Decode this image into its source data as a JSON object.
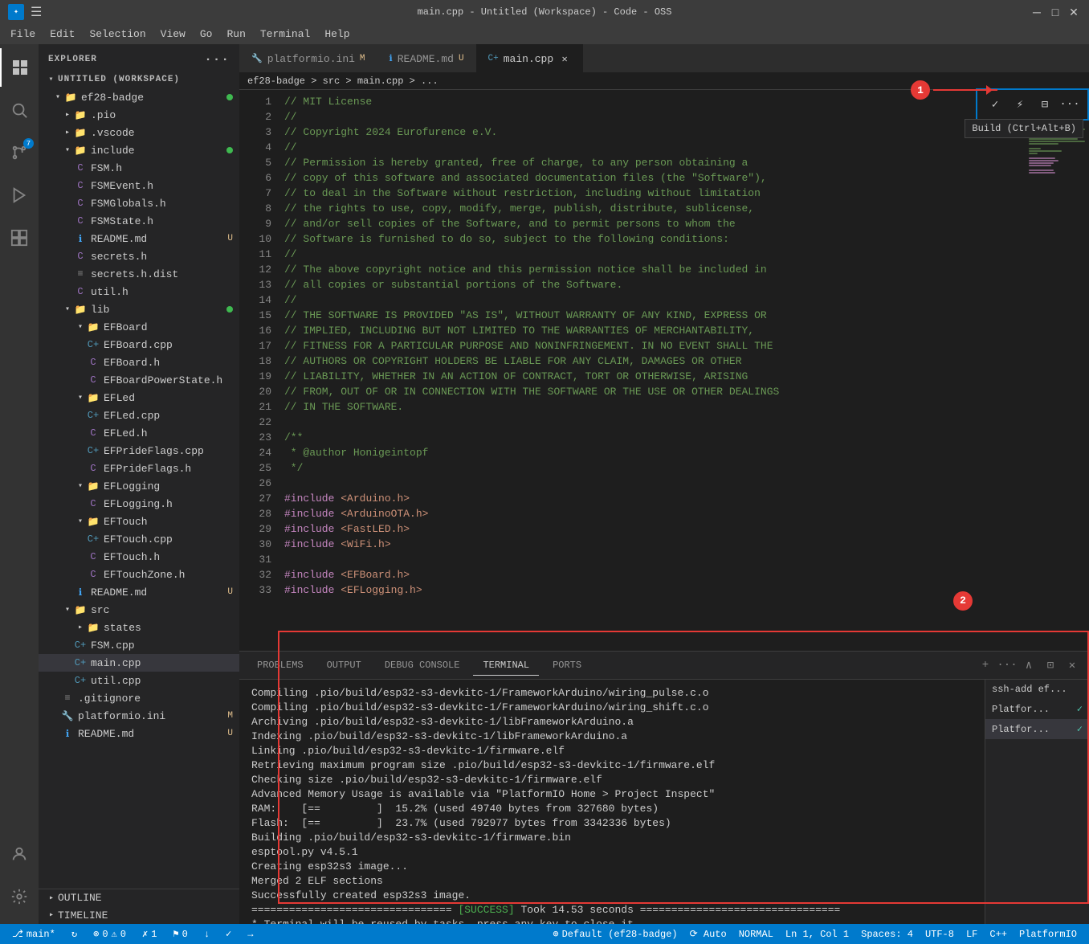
{
  "titleBar": {
    "title": "main.cpp - Untitled (Workspace) - Code - OSS",
    "winMin": "─",
    "winMax": "□",
    "winClose": "✕"
  },
  "menuBar": {
    "items": [
      "File",
      "Edit",
      "Selection",
      "View",
      "Go",
      "Run",
      "Terminal",
      "Help"
    ]
  },
  "activityBar": {
    "icons": [
      {
        "name": "explorer-icon",
        "symbol": "⬜",
        "active": true
      },
      {
        "name": "search-icon",
        "symbol": "🔍",
        "active": false
      },
      {
        "name": "source-control-icon",
        "symbol": "⎇",
        "active": false,
        "badge": "7"
      },
      {
        "name": "run-debug-icon",
        "symbol": "▷",
        "active": false
      },
      {
        "name": "extensions-icon",
        "symbol": "⊞",
        "active": false
      },
      {
        "name": "remote-explorer-icon",
        "symbol": "⊙",
        "active": false
      }
    ],
    "bottomIcons": [
      {
        "name": "account-icon",
        "symbol": "👤"
      },
      {
        "name": "settings-icon",
        "symbol": "⚙"
      }
    ]
  },
  "sidebar": {
    "header": "Explorer",
    "tree": {
      "workspace": "UNTITLED (WORKSPACE)",
      "items": [
        {
          "label": "ef28-badge",
          "type": "folder",
          "expanded": true,
          "indent": 0,
          "hasDot": true
        },
        {
          "label": ".pio",
          "type": "folder",
          "expanded": false,
          "indent": 1
        },
        {
          "label": ".vscode",
          "type": "folder",
          "expanded": false,
          "indent": 1
        },
        {
          "label": "include",
          "type": "folder",
          "expanded": true,
          "indent": 1,
          "hasDot": true
        },
        {
          "label": "FSM.h",
          "type": "c-header",
          "indent": 2
        },
        {
          "label": "FSMEvent.h",
          "type": "c-header",
          "indent": 2
        },
        {
          "label": "FSMGlobals.h",
          "type": "c-header",
          "indent": 2
        },
        {
          "label": "FSMState.h",
          "type": "c-header",
          "indent": 2
        },
        {
          "label": "README.md",
          "type": "info",
          "indent": 2,
          "modified": "U"
        },
        {
          "label": "secrets.h",
          "type": "c-header",
          "indent": 2
        },
        {
          "label": "secrets.h.dist",
          "type": "file",
          "indent": 2
        },
        {
          "label": "util.h",
          "type": "c-header",
          "indent": 2
        },
        {
          "label": "lib",
          "type": "folder",
          "expanded": true,
          "indent": 1,
          "hasDot": true
        },
        {
          "label": "EFBoard",
          "type": "folder",
          "expanded": true,
          "indent": 2
        },
        {
          "label": "EFBoard.cpp",
          "type": "c-plus",
          "indent": 3
        },
        {
          "label": "EFBoard.h",
          "type": "c-header",
          "indent": 3
        },
        {
          "label": "EFBoardPowerState.h",
          "type": "c-header",
          "indent": 3
        },
        {
          "label": "EFLed",
          "type": "folder",
          "expanded": true,
          "indent": 2
        },
        {
          "label": "EFLed.cpp",
          "type": "c-plus",
          "indent": 3
        },
        {
          "label": "EFLed.h",
          "type": "c-header",
          "indent": 3
        },
        {
          "label": "EFPrideFlags.cpp",
          "type": "c-plus",
          "indent": 3
        },
        {
          "label": "EFPrideFlags.h",
          "type": "c-header",
          "indent": 3
        },
        {
          "label": "EFLogging",
          "type": "folder",
          "expanded": true,
          "indent": 2
        },
        {
          "label": "EFLogging.h",
          "type": "c-header",
          "indent": 3
        },
        {
          "label": "EFTouch",
          "type": "folder",
          "expanded": true,
          "indent": 2
        },
        {
          "label": "EFTouch.cpp",
          "type": "c-plus",
          "indent": 3
        },
        {
          "label": "EFTouch.h",
          "type": "c-header",
          "indent": 3
        },
        {
          "label": "EFTouchZone.h",
          "type": "c-header",
          "indent": 3
        },
        {
          "label": "README.md",
          "type": "info",
          "indent": 2,
          "modified": "U"
        },
        {
          "label": "src",
          "type": "folder",
          "expanded": true,
          "indent": 1
        },
        {
          "label": "states",
          "type": "folder",
          "expanded": false,
          "indent": 2
        },
        {
          "label": "FSM.cpp",
          "type": "c-plus",
          "indent": 2
        },
        {
          "label": "main.cpp",
          "type": "c-plus",
          "indent": 2,
          "active": true
        },
        {
          "label": "util.cpp",
          "type": "c-plus",
          "indent": 2
        },
        {
          "label": ".gitignore",
          "type": "file",
          "indent": 1
        },
        {
          "label": "platformio.ini",
          "type": "platformio",
          "indent": 1,
          "modified": "M"
        },
        {
          "label": "README.md",
          "type": "info",
          "indent": 1,
          "modified": "U"
        }
      ]
    },
    "outline": "OUTLINE",
    "timeline": "TIMELINE"
  },
  "tabs": [
    {
      "label": "platformio.ini",
      "modified": "M",
      "active": false,
      "type": "platformio"
    },
    {
      "label": "README.md",
      "modified": "U",
      "active": false,
      "type": "info"
    },
    {
      "label": "main.cpp",
      "modified": "",
      "active": true,
      "type": "c-plus",
      "closeable": true
    }
  ],
  "breadcrumb": {
    "path": "ef28-badge > src > main.cpp > ..."
  },
  "toolbar": {
    "build_tooltip": "Build (Ctrl+Alt+B)"
  },
  "annotations": {
    "circle1": "1",
    "circle2": "2"
  },
  "codeLines": [
    {
      "num": 1,
      "content": "// MIT License",
      "type": "comment"
    },
    {
      "num": 2,
      "content": "//",
      "type": "comment"
    },
    {
      "num": 3,
      "content": "// Copyright 2024 Eurofurence e.V.",
      "type": "comment"
    },
    {
      "num": 4,
      "content": "//",
      "type": "comment"
    },
    {
      "num": 5,
      "content": "// Permission is hereby granted, free of charge, to any person obtaining a",
      "type": "comment"
    },
    {
      "num": 6,
      "content": "// copy of this software and associated documentation files (the \"Software\"),",
      "type": "comment"
    },
    {
      "num": 7,
      "content": "// to deal in the Software without restriction, including without limitation",
      "type": "comment"
    },
    {
      "num": 8,
      "content": "// the rights to use, copy, modify, merge, publish, distribute, sublicense,",
      "type": "comment"
    },
    {
      "num": 9,
      "content": "// and/or sell copies of the Software, and to permit persons to whom the",
      "type": "comment"
    },
    {
      "num": 10,
      "content": "// Software is furnished to do so, subject to the following conditions:",
      "type": "comment"
    },
    {
      "num": 11,
      "content": "//",
      "type": "comment"
    },
    {
      "num": 12,
      "content": "// The above copyright notice and this permission notice shall be included in",
      "type": "comment"
    },
    {
      "num": 13,
      "content": "// all copies or substantial portions of the Software.",
      "type": "comment"
    },
    {
      "num": 14,
      "content": "//",
      "type": "comment"
    },
    {
      "num": 15,
      "content": "// THE SOFTWARE IS PROVIDED \"AS IS\", WITHOUT WARRANTY OF ANY KIND, EXPRESS OR",
      "type": "comment"
    },
    {
      "num": 16,
      "content": "// IMPLIED, INCLUDING BUT NOT LIMITED TO THE WARRANTIES OF MERCHANTABILITY,",
      "type": "comment"
    },
    {
      "num": 17,
      "content": "// FITNESS FOR A PARTICULAR PURPOSE AND NONINFRINGEMENT. IN NO EVENT SHALL THE",
      "type": "comment"
    },
    {
      "num": 18,
      "content": "// AUTHORS OR COPYRIGHT HOLDERS BE LIABLE FOR ANY CLAIM, DAMAGES OR OTHER",
      "type": "comment"
    },
    {
      "num": 19,
      "content": "// LIABILITY, WHETHER IN AN ACTION OF CONTRACT, TORT OR OTHERWISE, ARISING",
      "type": "comment"
    },
    {
      "num": 20,
      "content": "// FROM, OUT OF OR IN CONNECTION WITH THE SOFTWARE OR THE USE OR OTHER DEALINGS",
      "type": "comment"
    },
    {
      "num": 21,
      "content": "// IN THE SOFTWARE.",
      "type": "comment"
    },
    {
      "num": 22,
      "content": "",
      "type": "normal"
    },
    {
      "num": 23,
      "content": "/**",
      "type": "comment"
    },
    {
      "num": 24,
      "content": " * @author Honigeintopf",
      "type": "comment"
    },
    {
      "num": 25,
      "content": " */",
      "type": "comment"
    },
    {
      "num": 26,
      "content": "",
      "type": "normal"
    },
    {
      "num": 27,
      "content": "#include <Arduino.h>",
      "type": "include"
    },
    {
      "num": 28,
      "content": "#include <ArduinoOTA.h>",
      "type": "include"
    },
    {
      "num": 29,
      "content": "#include <FastLED.h>",
      "type": "include"
    },
    {
      "num": 30,
      "content": "#include <WiFi.h>",
      "type": "include"
    },
    {
      "num": 31,
      "content": "",
      "type": "normal"
    },
    {
      "num": 32,
      "content": "#include <EFBoard.h>",
      "type": "include"
    },
    {
      "num": 33,
      "content": "#include <EFLogging.h>",
      "type": "include"
    }
  ],
  "terminal": {
    "tabs": [
      "PROBLEMS",
      "OUTPUT",
      "DEBUG CONSOLE",
      "TERMINAL",
      "PORTS"
    ],
    "activeTab": "TERMINAL",
    "lines": [
      "Compiling .pio/build/esp32-s3-devkitc-1/FrameworkArduino/wiring_pulse.c.o",
      "Compiling .pio/build/esp32-s3-devkitc-1/FrameworkArduino/wiring_shift.c.o",
      "Archiving .pio/build/esp32-s3-devkitc-1/libFrameworkArduino.a",
      "Indexing .pio/build/esp32-s3-devkitc-1/libFrameworkArduino.a",
      "Linking .pio/build/esp32-s3-devkitc-1/firmware.elf",
      "Retrieving maximum program size .pio/build/esp32-s3-devkitc-1/firmware.elf",
      "Checking size .pio/build/esp32-s3-devkitc-1/firmware.elf",
      "Advanced Memory Usage is available via \"PlatformIO Home > Project Inspect\"",
      "RAM:    [==         ]  15.2% (used 49740 bytes from 327680 bytes)",
      "Flash:  [==         ]  23.7% (used 792977 bytes from 3342336 bytes)",
      "Building .pio/build/esp32-s3-devkitc-1/firmware.bin",
      "esptool.py v4.5.1",
      "Creating esp32s3 image...",
      "Merged 2 ELF sections",
      "Successfully created esp32s3 image.",
      "============================= [SUCCESS] Took 14.53 seconds =============================",
      "* Terminal will be reused by tasks, press any key to close it."
    ],
    "successLine": 15,
    "sessions": [
      {
        "label": "ssh-add ef...",
        "active": false
      },
      {
        "label": "Platfor...",
        "active": false,
        "check": true
      },
      {
        "label": "Platfor...",
        "active": true,
        "check": true
      }
    ]
  },
  "statusBar": {
    "left": [
      {
        "icon": "⎇",
        "text": "main*"
      },
      {
        "icon": "↻",
        "text": ""
      },
      {
        "icon": "⚠",
        "text": "0"
      },
      {
        "icon": "⊗",
        "text": "0"
      },
      {
        "icon": "✗",
        "text": "1"
      },
      {
        "icon": "⚑",
        "text": "0"
      },
      {
        "icon": "↓",
        "text": ""
      },
      {
        "icon": "✓",
        "text": ""
      },
      {
        "icon": "→",
        "text": ""
      }
    ],
    "right": [
      {
        "text": "⊕ Default (ef28-badge)"
      },
      {
        "text": "⟳ Auto"
      },
      {
        "text": "NORMAL"
      },
      {
        "text": "Ln 1, Col 1"
      },
      {
        "text": "Spaces: 4"
      },
      {
        "text": "UTF-8"
      },
      {
        "text": "LF"
      },
      {
        "text": "C++"
      },
      {
        "text": "PlatformIO"
      }
    ]
  }
}
